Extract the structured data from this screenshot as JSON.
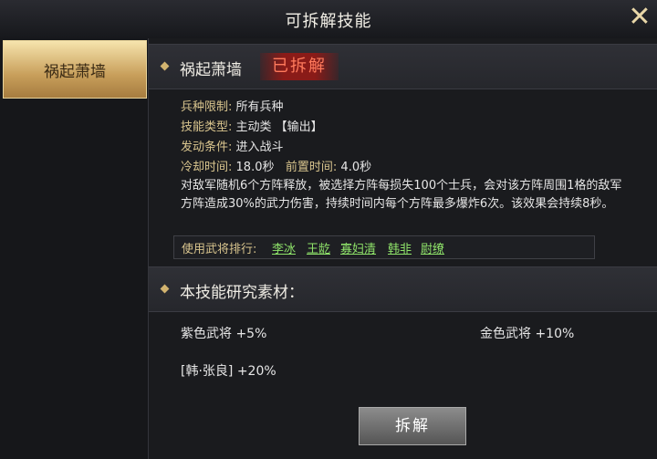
{
  "window": {
    "title": "可拆解技能"
  },
  "sidebar": {
    "items": [
      {
        "label": "祸起萧墙"
      }
    ]
  },
  "skill": {
    "name": "祸起萧墙",
    "status_badge": "已拆解",
    "troop_label": "兵种限制:",
    "troop_value": "所有兵种",
    "type_label": "技能类型:",
    "type_value": "主动类 【输出】",
    "trigger_label": "发动条件:",
    "trigger_value": "进入战斗",
    "cooldown_label": "冷却时间:",
    "cooldown_value": "18.0秒",
    "precast_label": "前置时间:",
    "precast_value": "4.0秒",
    "description": "对敌军随机6个方阵释放，被选择方阵每损失100个士兵，会对该方阵周围1格的敌军方阵造成30%的武力伤害，持续时间内每个方阵最多爆炸6次。该效果会持续8秒。",
    "ranking_label": "使用武将排行:",
    "ranking": [
      "李冰",
      "王龁",
      "寡妇清",
      "韩非",
      "尉缭"
    ]
  },
  "materials": {
    "header": "本技能研究素材：",
    "purple": "紫色武将 +5%",
    "gold": "金色武将 +10%",
    "special": "[韩·张良] +20%"
  },
  "actions": {
    "disassemble_label": "拆解"
  },
  "icons": {
    "close": "close-icon"
  },
  "colors": {
    "accent_gold": "#d9c58e",
    "badge_red": "#ff7a5c",
    "general_green": "#8fe36a"
  }
}
